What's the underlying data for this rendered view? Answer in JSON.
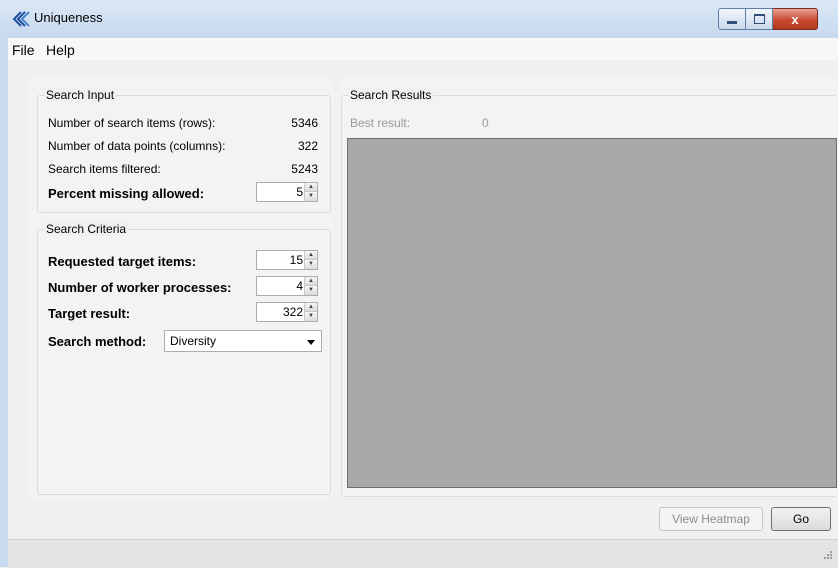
{
  "window": {
    "title": "Uniqueness",
    "app_icon": "uniqueness-logo-icon",
    "close_glyph": "x"
  },
  "menu": {
    "items": [
      {
        "label": "File"
      },
      {
        "label": "Help"
      }
    ]
  },
  "search_input": {
    "title": "Search Input",
    "rows_label": "Number of search items (rows):",
    "rows_value": "5346",
    "columns_label": "Number of data points (columns):",
    "columns_value": "322",
    "filtered_label": "Search items filtered:",
    "filtered_value": "5243",
    "percent_missing_label": "Percent missing allowed:",
    "percent_missing_value": "5"
  },
  "search_criteria": {
    "title": "Search Criteria",
    "target_items_label": "Requested target items:",
    "target_items_value": "15",
    "workers_label": "Number of worker processes:",
    "workers_value": "4",
    "target_result_label": "Target result:",
    "target_result_value": "322",
    "method_label": "Search method:",
    "method_value": "Diversity"
  },
  "search_results": {
    "title": "Search Results",
    "best_result_label": "Best result:",
    "best_result_value": "0"
  },
  "actions": {
    "view_heatmap_label": "View Heatmap",
    "go_label": "Go"
  },
  "colors": {
    "title_bar": "#c9daee",
    "results_area": "#a8a8a8",
    "close_button": "#c94a33"
  }
}
